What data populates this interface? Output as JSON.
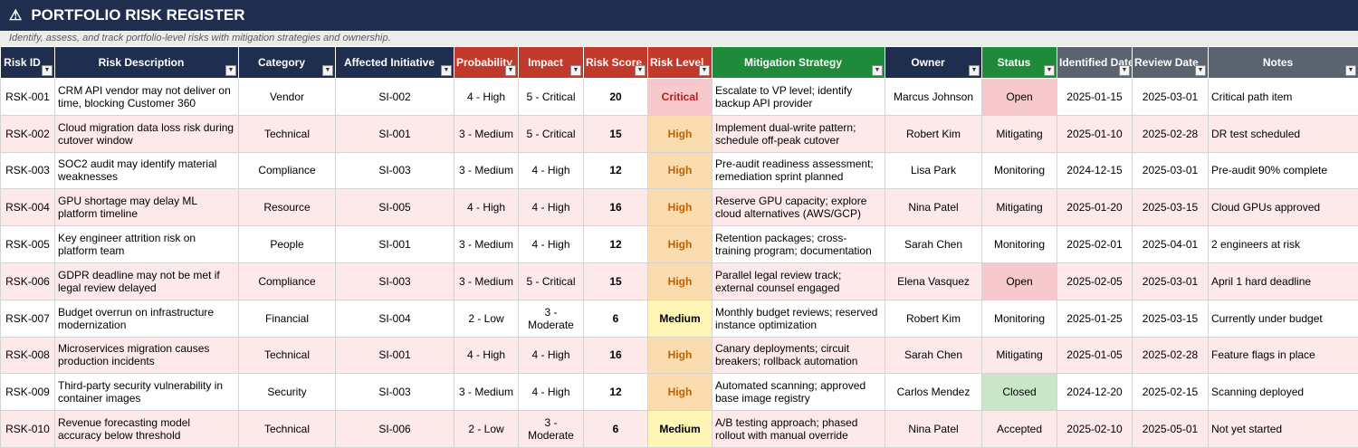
{
  "title": "PORTFOLIO RISK REGISTER",
  "subtitle": "Identify, assess, and track portfolio-level risks with mitigation strategies and ownership.",
  "colors": {
    "navy": "#1f2d4f",
    "red": "#c0392b",
    "green": "#1e8a3a",
    "gray": "#5a6470",
    "critical_bg": "#f8c9cc",
    "high_bg": "#fbdcae",
    "medium_bg": "#fff6b5",
    "closed_bg": "#c9e6c9",
    "row_alt": "#fde8ea"
  },
  "columns": [
    {
      "label": "Risk ID",
      "color": "navy"
    },
    {
      "label": "Risk Description",
      "color": "navy"
    },
    {
      "label": "Category",
      "color": "navy"
    },
    {
      "label": "Affected Initiative",
      "color": "navy"
    },
    {
      "label": "Probability",
      "color": "red"
    },
    {
      "label": "Impact",
      "color": "red"
    },
    {
      "label": "Risk Score",
      "color": "red"
    },
    {
      "label": "Risk Level",
      "color": "red"
    },
    {
      "label": "Mitigation Strategy",
      "color": "green"
    },
    {
      "label": "Owner",
      "color": "navy"
    },
    {
      "label": "Status",
      "color": "green"
    },
    {
      "label": "Identified Date",
      "color": "gray"
    },
    {
      "label": "Review Date",
      "color": "gray"
    },
    {
      "label": "Notes",
      "color": "gray"
    }
  ],
  "rows": [
    {
      "id": "RSK-001",
      "desc": "CRM API vendor may not deliver on time, blocking Customer 360",
      "category": "Vendor",
      "initiative": "SI-002",
      "probability": "4 - High",
      "impact": "5 - Critical",
      "score": "20",
      "level": "Critical",
      "mitigation": "Escalate to VP level; identify backup API provider",
      "owner": "Marcus Johnson",
      "status": "Open",
      "identified": "2025-01-15",
      "review": "2025-03-01",
      "notes": "Critical path item"
    },
    {
      "id": "RSK-002",
      "desc": "Cloud migration data loss risk during cutover window",
      "category": "Technical",
      "initiative": "SI-001",
      "probability": "3 - Medium",
      "impact": "5 - Critical",
      "score": "15",
      "level": "High",
      "mitigation": "Implement dual-write pattern; schedule off-peak cutover",
      "owner": "Robert Kim",
      "status": "Mitigating",
      "identified": "2025-01-10",
      "review": "2025-02-28",
      "notes": "DR test scheduled"
    },
    {
      "id": "RSK-003",
      "desc": "SOC2 audit may identify material weaknesses",
      "category": "Compliance",
      "initiative": "SI-003",
      "probability": "3 - Medium",
      "impact": "4 - High",
      "score": "12",
      "level": "High",
      "mitigation": "Pre-audit readiness assessment; remediation sprint planned",
      "owner": "Lisa Park",
      "status": "Monitoring",
      "identified": "2024-12-15",
      "review": "2025-03-01",
      "notes": "Pre-audit 90% complete"
    },
    {
      "id": "RSK-004",
      "desc": "GPU shortage may delay ML platform timeline",
      "category": "Resource",
      "initiative": "SI-005",
      "probability": "4 - High",
      "impact": "4 - High",
      "score": "16",
      "level": "High",
      "mitigation": "Reserve GPU capacity; explore cloud alternatives (AWS/GCP)",
      "owner": "Nina Patel",
      "status": "Mitigating",
      "identified": "2025-01-20",
      "review": "2025-03-15",
      "notes": "Cloud GPUs approved"
    },
    {
      "id": "RSK-005",
      "desc": "Key engineer attrition risk on platform team",
      "category": "People",
      "initiative": "SI-001",
      "probability": "3 - Medium",
      "impact": "4 - High",
      "score": "12",
      "level": "High",
      "mitigation": "Retention packages; cross-training program; documentation",
      "owner": "Sarah Chen",
      "status": "Monitoring",
      "identified": "2025-02-01",
      "review": "2025-04-01",
      "notes": "2 engineers at risk"
    },
    {
      "id": "RSK-006",
      "desc": "GDPR deadline may not be met if legal review delayed",
      "category": "Compliance",
      "initiative": "SI-003",
      "probability": "3 - Medium",
      "impact": "5 - Critical",
      "score": "15",
      "level": "High",
      "mitigation": "Parallel legal review track; external counsel engaged",
      "owner": "Elena Vasquez",
      "status": "Open",
      "identified": "2025-02-05",
      "review": "2025-03-01",
      "notes": "April 1 hard deadline"
    },
    {
      "id": "RSK-007",
      "desc": "Budget overrun on infrastructure modernization",
      "category": "Financial",
      "initiative": "SI-004",
      "probability": "2 - Low",
      "impact": "3 - Moderate",
      "score": "6",
      "level": "Medium",
      "mitigation": "Monthly budget reviews; reserved instance optimization",
      "owner": "Robert Kim",
      "status": "Monitoring",
      "identified": "2025-01-25",
      "review": "2025-03-15",
      "notes": "Currently under budget"
    },
    {
      "id": "RSK-008",
      "desc": "Microservices migration causes production incidents",
      "category": "Technical",
      "initiative": "SI-001",
      "probability": "4 - High",
      "impact": "4 - High",
      "score": "16",
      "level": "High",
      "mitigation": "Canary deployments; circuit breakers; rollback automation",
      "owner": "Sarah Chen",
      "status": "Mitigating",
      "identified": "2025-01-05",
      "review": "2025-02-28",
      "notes": "Feature flags in place"
    },
    {
      "id": "RSK-009",
      "desc": "Third-party security vulnerability in container images",
      "category": "Security",
      "initiative": "SI-003",
      "probability": "3 - Medium",
      "impact": "4 - High",
      "score": "12",
      "level": "High",
      "mitigation": "Automated scanning; approved base image registry",
      "owner": "Carlos Mendez",
      "status": "Closed",
      "identified": "2024-12-20",
      "review": "2025-02-15",
      "notes": "Scanning deployed"
    },
    {
      "id": "RSK-010",
      "desc": "Revenue forecasting model accuracy below threshold",
      "category": "Technical",
      "initiative": "SI-006",
      "probability": "2 - Low",
      "impact": "3 - Moderate",
      "score": "6",
      "level": "Medium",
      "mitigation": "A/B testing approach; phased rollout with manual override",
      "owner": "Nina Patel",
      "status": "Accepted",
      "identified": "2025-02-10",
      "review": "2025-05-01",
      "notes": "Not yet started"
    }
  ]
}
